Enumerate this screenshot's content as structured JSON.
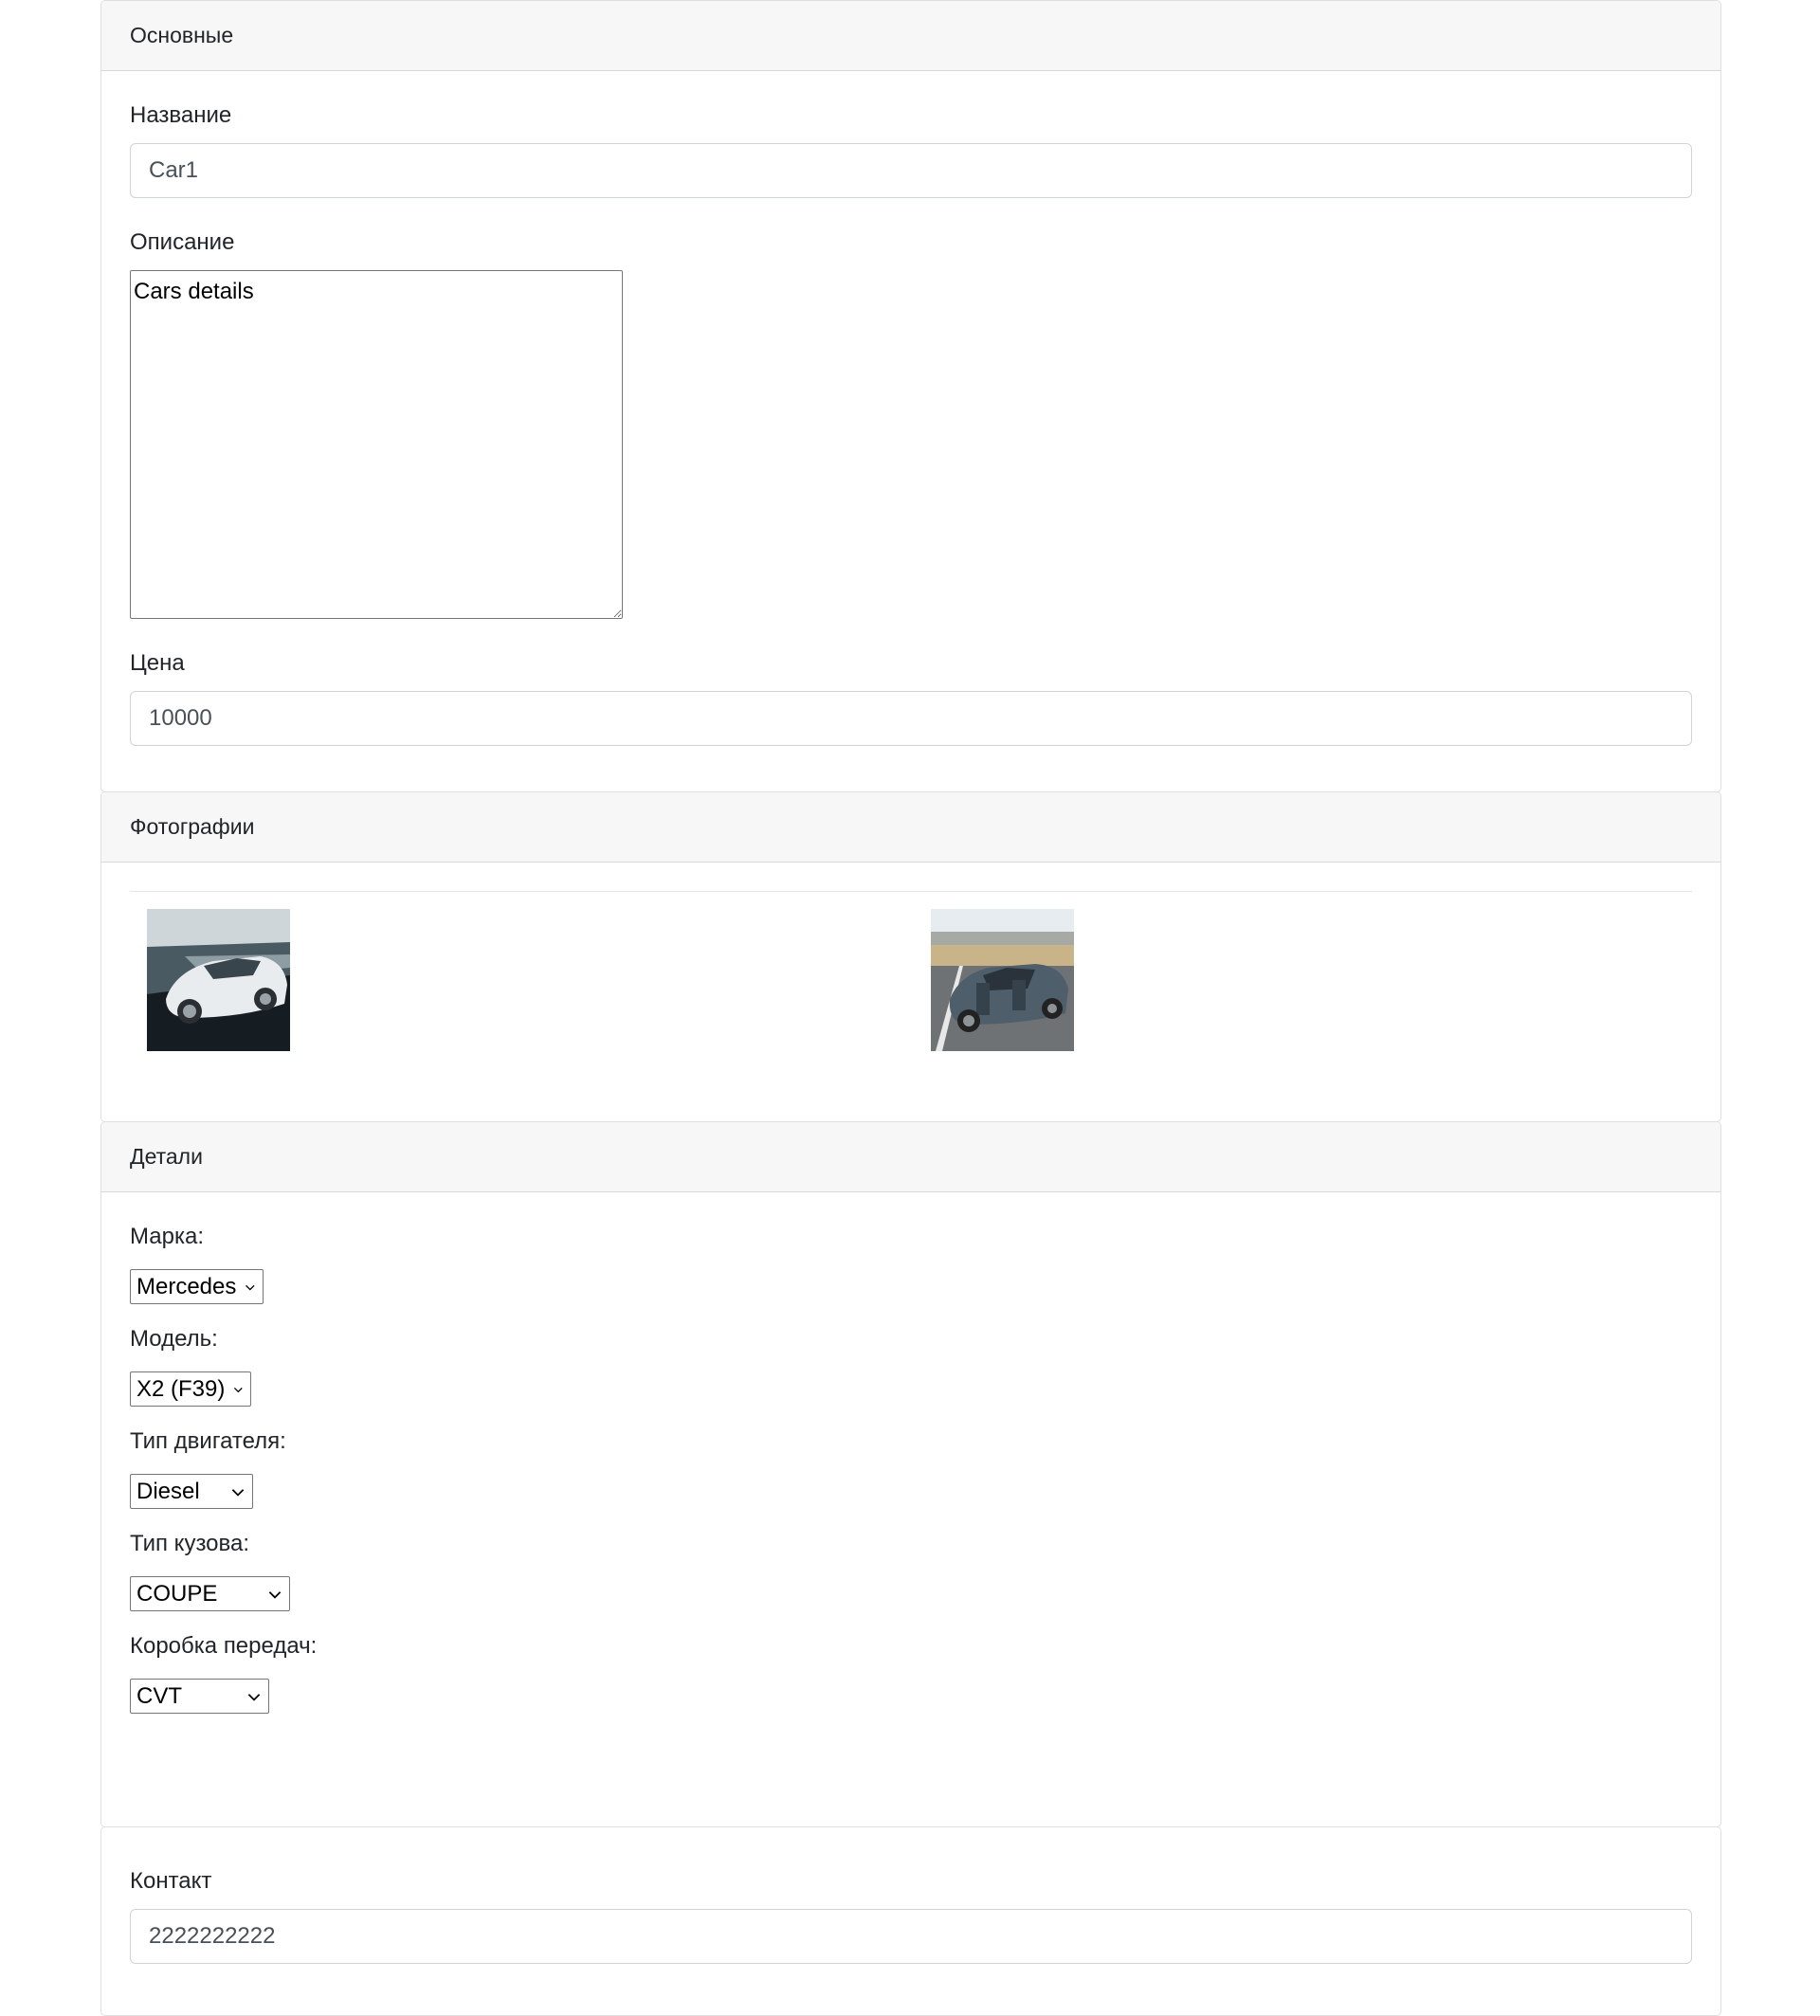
{
  "sections": {
    "basic": {
      "header": "Основные",
      "name_label": "Название",
      "name_value": "Car1",
      "description_label": "Описание",
      "description_value": "Cars details",
      "price_label": "Цена",
      "price_value": "10000"
    },
    "photos": {
      "header": "Фотографии",
      "items": [
        {
          "alt": "white-sedan-photo"
        },
        {
          "alt": "grey-suv-photo"
        }
      ]
    },
    "details": {
      "header": "Детали",
      "brand_label": "Марка:",
      "brand_value": "Mercedes",
      "model_label": "Модель:",
      "model_value": "X2 (F39)",
      "engine_label": "Тип двигателя:",
      "engine_value": "Diesel",
      "body_label": "Тип кузова:",
      "body_value": "COUPE",
      "gearbox_label": "Коробка передач:",
      "gearbox_value": "CVT"
    },
    "contact": {
      "label": "Контакт",
      "value": "2222222222"
    }
  },
  "colors": {
    "header_bg": "#f7f7f7",
    "border": "#dfdfdf",
    "input_text": "#495057"
  }
}
